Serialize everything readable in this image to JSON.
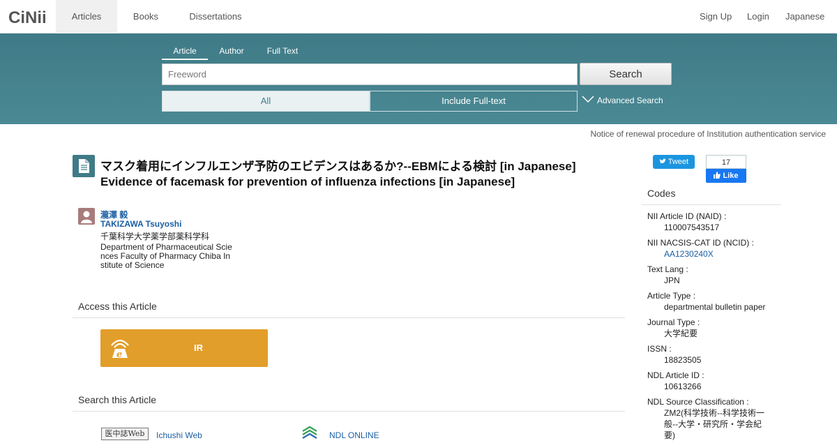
{
  "header": {
    "logo": "CiNii",
    "tabs": [
      "Articles",
      "Books",
      "Dissertations"
    ],
    "right_links": [
      "Sign Up",
      "Login",
      "Japanese"
    ]
  },
  "search": {
    "tabs": [
      "Article",
      "Author",
      "Full Text"
    ],
    "placeholder": "Freeword",
    "button": "Search",
    "scope_all": "All",
    "scope_full": "Include Full-text",
    "advanced": "Advanced Search"
  },
  "notice": "Notice of renewal procedure of Institution authentication service",
  "article": {
    "title_ja": "マスク着用にインフルエンザ予防のエビデンスはあるか?--EBMによる検討  [in Japanese]",
    "title_en": "Evidence of facemask for prevention of influenza infections  [in Japanese]",
    "author_ja": "瀧澤 毅",
    "author_en": "TAKIZAWA Tsuyoshi",
    "aff_ja": "千葉科学大学薬学部薬科学科",
    "aff_en_1": "Department of Pharmaceutical Scie",
    "aff_en_2": "nces Faculty of Pharmacy Chiba In",
    "aff_en_3": "stitute of Science"
  },
  "access": {
    "title": "Access this Article",
    "ir_label": "IR"
  },
  "search_article": {
    "title": "Search this Article",
    "ichushi_logo": "医中誌Web",
    "ichushi_link": "Ichushi Web",
    "ndl_link": "NDL ONLINE"
  },
  "social": {
    "tweet": "Tweet",
    "fb_count": "17",
    "fb_like": "Like"
  },
  "codes": {
    "title": "Codes",
    "items": [
      {
        "label": "NII Article ID (NAID) :",
        "value": "110007543517"
      },
      {
        "label": "NII NACSIS-CAT ID (NCID) :",
        "value": "AA1230240X"
      },
      {
        "label": "Text Lang :",
        "value": "JPN"
      },
      {
        "label": "Article Type :",
        "value": "departmental bulletin paper"
      },
      {
        "label": "Journal Type :",
        "value": "大学紀要"
      },
      {
        "label": "ISSN :",
        "value": "18823505"
      },
      {
        "label": "NDL Article ID :",
        "value": "10613266"
      },
      {
        "label": "NDL Source Classification :",
        "value_1": "ZM2(科学技術--科学技術一",
        "value_2": "般--大学・研究所・学会紀",
        "value_3": "要)"
      }
    ]
  },
  "colors": {
    "accent": "#3f7a87",
    "link": "#1a5fa3",
    "ir": "#e29e2a"
  }
}
